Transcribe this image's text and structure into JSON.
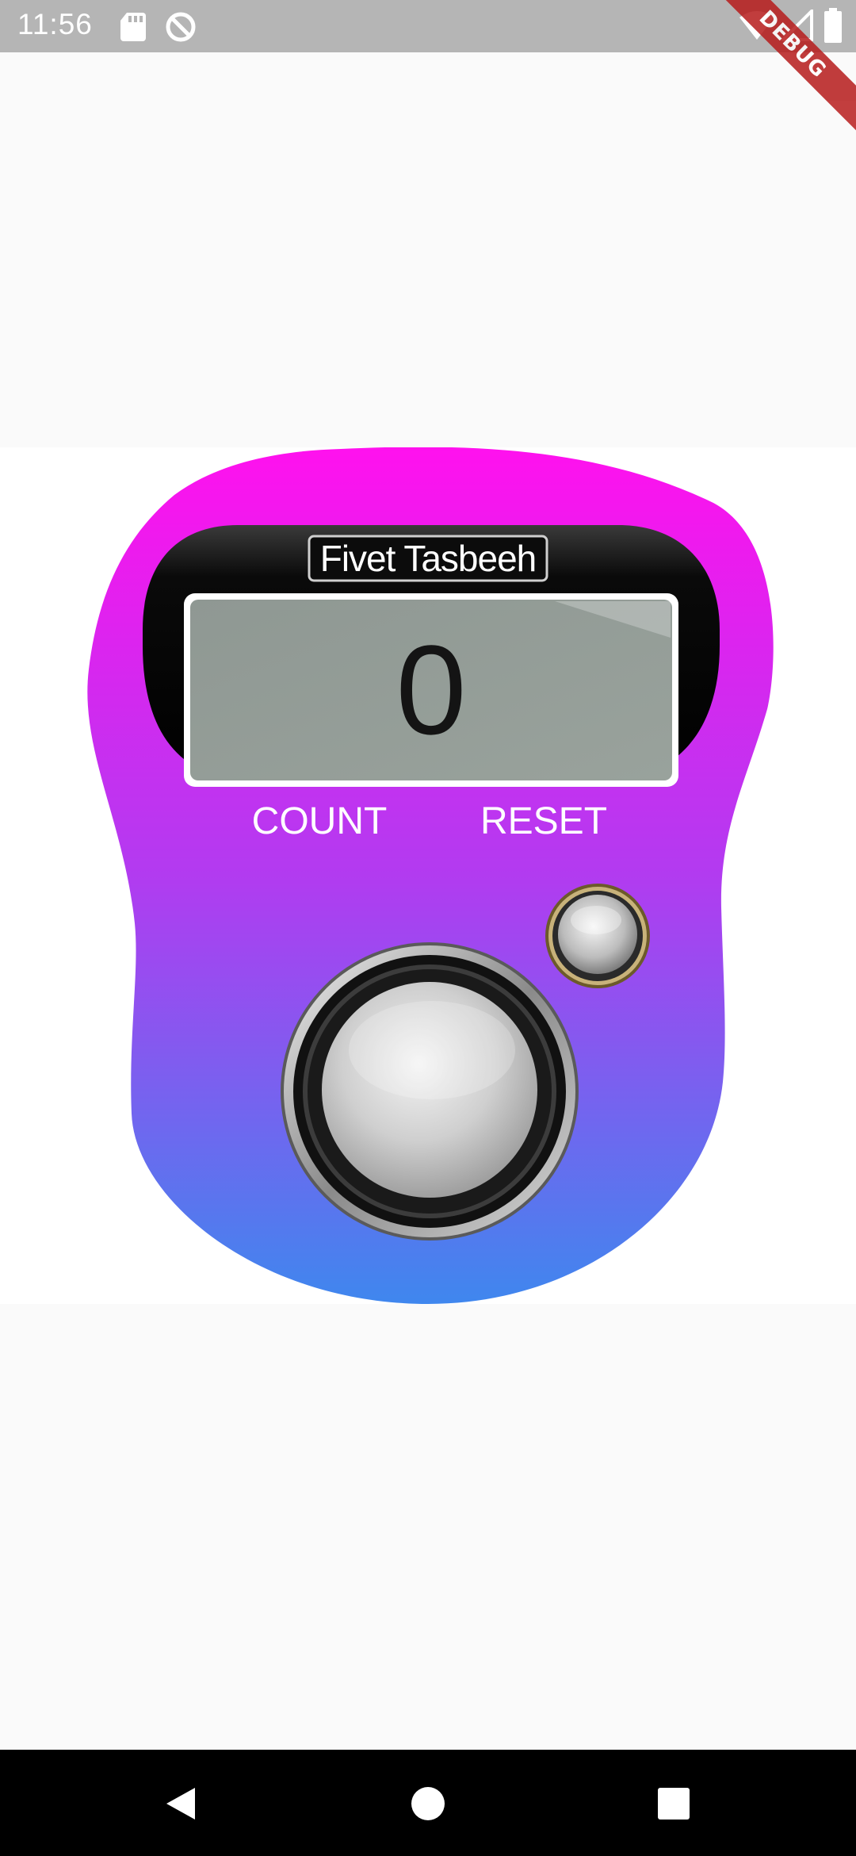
{
  "status_bar": {
    "time": "11:56",
    "icons": [
      "sd-card-icon",
      "sync-blocked-icon",
      "wifi-icon",
      "signal-icon",
      "battery-icon"
    ],
    "debug_label": "DEBUG"
  },
  "counter": {
    "title": "Fivet Tasbeeh",
    "count_value": "0",
    "count_label": "COUNT",
    "reset_label": "RESET",
    "colors": {
      "body_top": "#ff11ee",
      "body_middle": "#b23bf0",
      "body_bottom": "#3f87ee",
      "screen_bezel": "#000000",
      "lcd": "#959e98"
    }
  },
  "nav_bar": {
    "buttons": [
      "back-icon",
      "home-icon",
      "recents-icon"
    ]
  }
}
